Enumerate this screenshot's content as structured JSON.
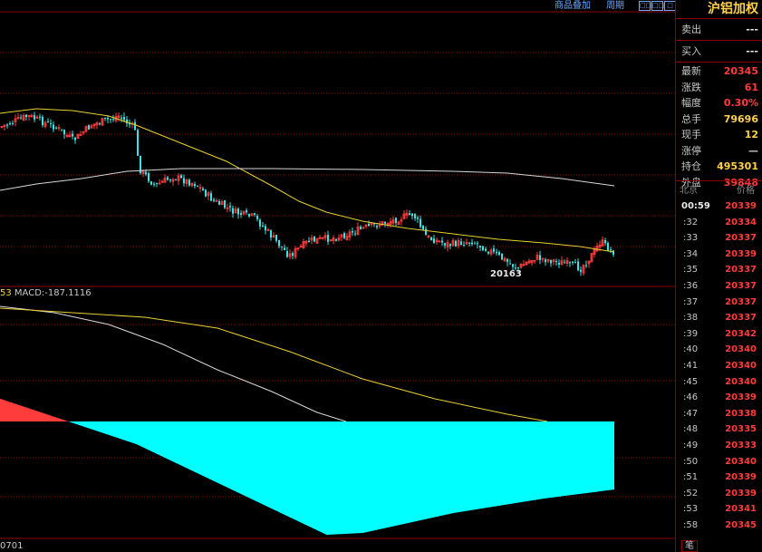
{
  "toolbar": {
    "overlay_label": "商品叠加",
    "period_label": "周期",
    "btn1": "□□",
    "btn2": "□□",
    "btn3": "□"
  },
  "instrument": {
    "name": "沪铝加权"
  },
  "quote": {
    "sell_label": "卖出",
    "sell_value": "---",
    "buy_label": "买入",
    "buy_value": "---",
    "rows": [
      {
        "label": "最新",
        "value": "20345",
        "color": "#ff3c3c"
      },
      {
        "label": "涨跌",
        "value": "61",
        "color": "#ff3c3c"
      },
      {
        "label": "幅度",
        "value": "0.30%",
        "color": "#ff3c3c"
      },
      {
        "label": "总手",
        "value": "79696",
        "color": "#ffd24a"
      },
      {
        "label": "现手",
        "value": "12",
        "color": "#ffd24a"
      },
      {
        "label": "涨停",
        "value": "—",
        "color": "#c8c8c8"
      },
      {
        "label": "持仓",
        "value": "495301",
        "color": "#ffd24a"
      },
      {
        "label": "外盘",
        "value": "39848",
        "color": "#ff3c3c"
      }
    ]
  },
  "ticks": {
    "header_left": "北京",
    "header_right": "价格",
    "rows": [
      {
        "time": "00:59",
        "price": "20339"
      },
      {
        "time": ":32",
        "price": "20334"
      },
      {
        "time": ":33",
        "price": "20337"
      },
      {
        "time": ":34",
        "price": "20339"
      },
      {
        "time": ":35",
        "price": "20337"
      },
      {
        "time": ":36",
        "price": "20337"
      },
      {
        "time": ":37",
        "price": "20337"
      },
      {
        "time": ":38",
        "price": "20337"
      },
      {
        "time": ":39",
        "price": "20342"
      },
      {
        "time": ":40",
        "price": "20340"
      },
      {
        "time": ":41",
        "price": "20340"
      },
      {
        "time": ":45",
        "price": "20340"
      },
      {
        "time": ":46",
        "price": "20339"
      },
      {
        "time": ":47",
        "price": "20338"
      },
      {
        "time": ":48",
        "price": "20335"
      },
      {
        "time": ":49",
        "price": "20333"
      },
      {
        "time": ":50",
        "price": "20340"
      },
      {
        "time": ":51",
        "price": "20339"
      },
      {
        "time": ":52",
        "price": "20339"
      },
      {
        "time": ":53",
        "price": "20341"
      },
      {
        "time": ":58",
        "price": "20345"
      }
    ],
    "tab_label": "笔"
  },
  "chart": {
    "low_label": "20163",
    "macd_prefix": "53",
    "macd_label": "MACD:-187.1116",
    "x_label": "0701",
    "colors": {
      "up": "#ff3c3c",
      "down": "#36e6e6",
      "ma_yellow": "#e8d030",
      "ma_white": "#d8d8d8",
      "grid": "#8b0000",
      "macd_pos": "#ff3c3c",
      "macd_neg": "#00ffff"
    }
  }
}
